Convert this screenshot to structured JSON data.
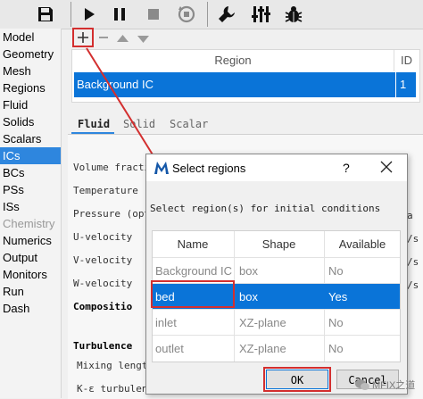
{
  "toolbar": {
    "icons": [
      "save-icon",
      "play-icon",
      "pause-icon",
      "stop-icon",
      "reset-icon",
      "wrench-icon",
      "sliders-icon",
      "bug-icon"
    ]
  },
  "sidebar": {
    "items": [
      {
        "label": "Model"
      },
      {
        "label": "Geometry"
      },
      {
        "label": "Mesh"
      },
      {
        "label": "Regions"
      },
      {
        "label": "Fluid"
      },
      {
        "label": "Solids"
      },
      {
        "label": "Scalars"
      },
      {
        "label": "ICs",
        "active": true
      },
      {
        "label": "BCs"
      },
      {
        "label": "PSs"
      },
      {
        "label": "ISs"
      },
      {
        "label": "Chemistry",
        "disabled": true
      },
      {
        "label": "Numerics"
      },
      {
        "label": "Output"
      },
      {
        "label": "Monitors"
      },
      {
        "label": "Run"
      },
      {
        "label": "Dash"
      }
    ]
  },
  "regions_table": {
    "headers": [
      "Region",
      "ID"
    ],
    "rows": [
      {
        "region": "Background IC",
        "id": "1"
      }
    ]
  },
  "tabs": [
    "Fluid",
    "Solid",
    "Scalar"
  ],
  "fluid_panel": {
    "labels": [
      "Volume fractic",
      "Temperature",
      "Pressure (opti",
      "U-velocity",
      "V-velocity",
      "W-velocity",
      "Compositio",
      "Turbulence",
      "Mixing length",
      "K-ε  turbulen"
    ],
    "right_fragments": [
      "a",
      "/s",
      "/s",
      "/s"
    ]
  },
  "dialog": {
    "title": "Select regions",
    "help": "?",
    "prompt": "Select region(s) for initial conditions",
    "headers": [
      "Name",
      "Shape",
      "Available"
    ],
    "rows": [
      {
        "name": "Background IC",
        "shape": "box",
        "available": "No",
        "selected": false
      },
      {
        "name": "bed",
        "shape": "box",
        "available": "Yes",
        "selected": true
      },
      {
        "name": "inlet",
        "shape": "XZ-plane",
        "available": "No",
        "selected": false
      },
      {
        "name": "outlet",
        "shape": "XZ-plane",
        "available": "No",
        "selected": false
      }
    ],
    "ok_label": "OK",
    "cancel_label": "Cancel"
  },
  "watermark": "MFIX之道",
  "accent": "#0a74d8",
  "highlight": "#d32f2f"
}
